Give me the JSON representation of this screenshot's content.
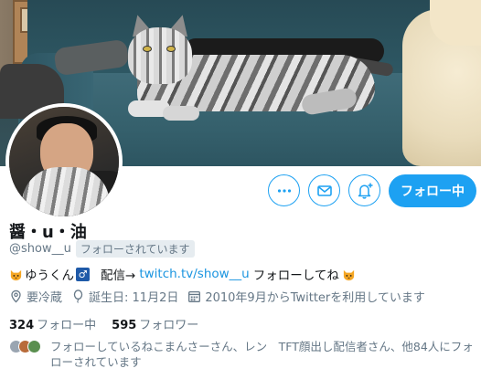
{
  "profile": {
    "display_name": "醤・u・油",
    "handle": "@show__u",
    "follows_you_badge": "フォローされています",
    "bio": {
      "name_part": "ゆうくん",
      "stream_label": "配信→",
      "link_text": "twitch.tv/show__u",
      "tail_text": "フォローしてね",
      "male_symbol": "♂"
    },
    "location": "要冷蔵",
    "birthday": "誕生日: 11月2日",
    "joined": "2010年9月からTwitterを利用しています"
  },
  "stats": {
    "following_count": "324",
    "following_label": "フォロー中",
    "followers_count": "595",
    "followers_label": "フォロワー"
  },
  "followers_you_know": "フォローしているねこまんさーさん、レン　TFT顔出し配信者さん、他84人にフォローされています",
  "actions": {
    "follow_label": "フォロー中"
  },
  "colors": {
    "accent": "#1da1f2",
    "link": "#1b95e0",
    "secondary_text": "#657786",
    "primary_text": "#14171a"
  },
  "icons": {
    "more": "more-icon",
    "message": "envelope-icon",
    "notify": "bell-plus-icon",
    "location": "location-pin-icon",
    "birthday": "balloon-icon",
    "calendar": "calendar-icon",
    "emoji_cat": "cat-face-emoji",
    "male": "male-sign-emoji"
  }
}
